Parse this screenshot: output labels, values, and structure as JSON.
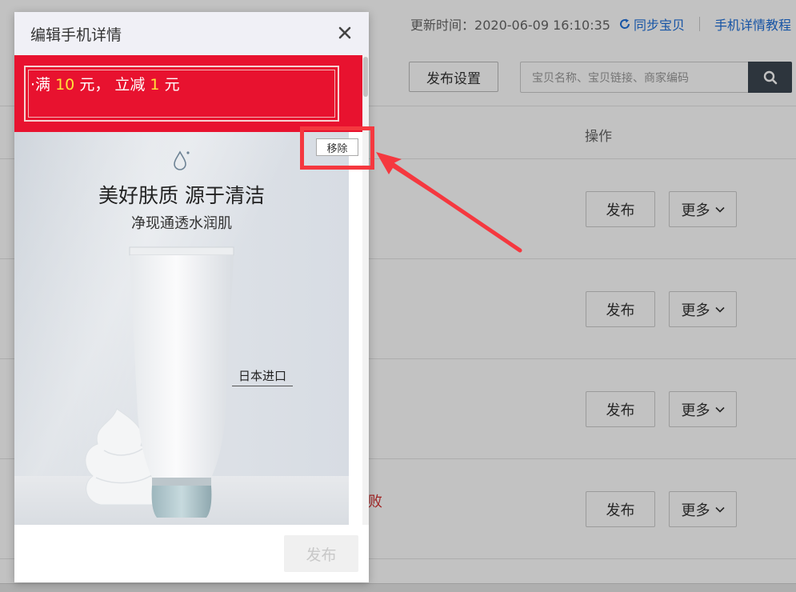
{
  "topbar": {
    "update_time": "更新时间：2020-06-09 16:10:35",
    "sync_label": "同步宝贝",
    "tutorial_label": "手机详情教程"
  },
  "toolbar": {
    "publish_settings_label": "发布设置",
    "search_placeholder": "宝贝名称、宝贝链接、商家编码"
  },
  "table": {
    "operation_header": "操作",
    "rows": [
      {
        "publish_label": "发布",
        "more_label": "更多",
        "status": ""
      },
      {
        "publish_label": "发布",
        "more_label": "更多",
        "status": ""
      },
      {
        "publish_label": "发布",
        "more_label": "更多",
        "status": ""
      },
      {
        "publish_label": "发布",
        "more_label": "更多",
        "status": "败"
      }
    ]
  },
  "dialog": {
    "title": "编辑手机详情",
    "promo": {
      "prefix": "·满",
      "threshold": "10",
      "mid": "元，  立减",
      "discount": "1",
      "suffix": "元"
    },
    "product": {
      "headline": "美好肤质 源于清洁",
      "subline": "净现通透水润肌",
      "badge": "日本进口"
    },
    "remove_label": "移除",
    "publish_label": "发布"
  },
  "colors": {
    "promo_red": "#e8122f",
    "promo_highlight": "#ffe23a",
    "link_blue": "#1e6fd9",
    "annotation_red": "#f5383f",
    "search_button": "#3c4651"
  }
}
